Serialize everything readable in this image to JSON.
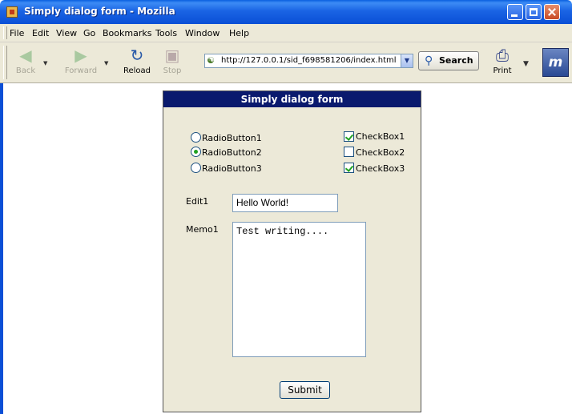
{
  "window": {
    "title": "Simply dialog form - Mozilla"
  },
  "menu": [
    "File",
    "Edit",
    "View",
    "Go",
    "Bookmarks",
    "Tools",
    "Window",
    "Help"
  ],
  "toolbar": {
    "back": "Back",
    "forward": "Forward",
    "reload": "Reload",
    "stop": "Stop",
    "url": "http://127.0.0.1/sid_f698581206/index.html",
    "search": "Search",
    "print": "Print"
  },
  "form": {
    "title": "Simply dialog form",
    "radios": [
      {
        "label": "RadioButton1",
        "checked": false
      },
      {
        "label": "RadioButton2",
        "checked": true
      },
      {
        "label": "RadioButton3",
        "checked": false
      }
    ],
    "checkboxes": [
      {
        "label": "CheckBox1",
        "checked": true
      },
      {
        "label": "CheckBox2",
        "checked": false
      },
      {
        "label": "CheckBox3",
        "checked": true
      }
    ],
    "edit_label": "Edit1",
    "edit_value": "Hello World!",
    "memo_label": "Memo1",
    "memo_value": "Test writing....",
    "submit": "Submit"
  }
}
